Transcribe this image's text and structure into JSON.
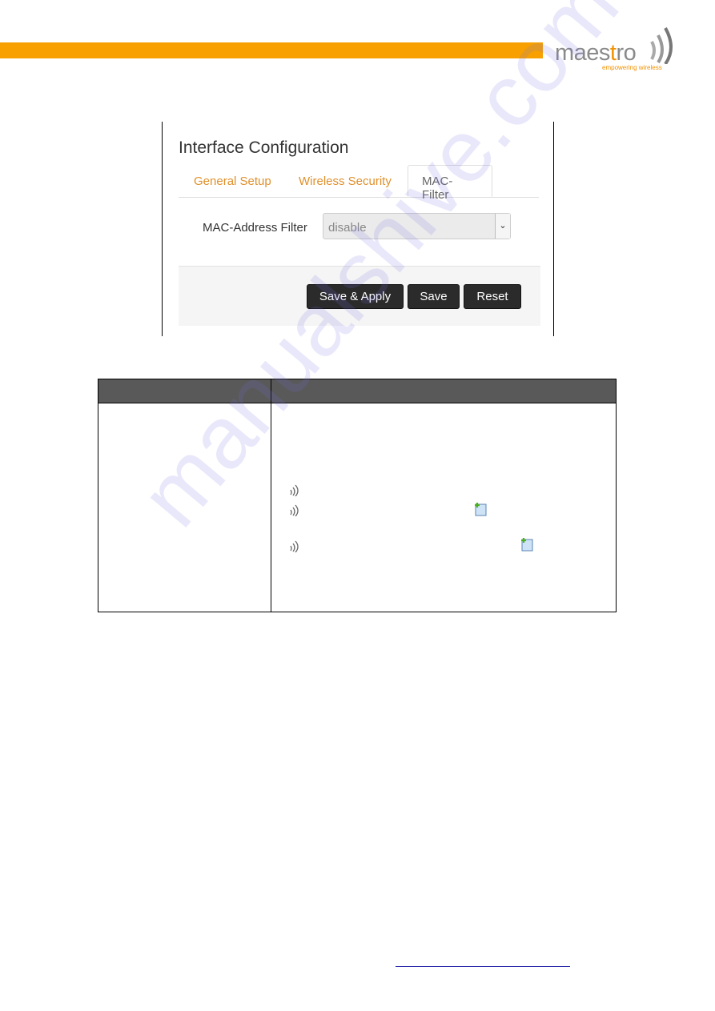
{
  "header": {
    "brand_color": "#f7a000"
  },
  "logo": {
    "text": "maestro",
    "tagline": "empowering wireless"
  },
  "screenshot": {
    "title": "Interface Configuration",
    "tabs": [
      {
        "label": "General Setup",
        "active": false
      },
      {
        "label": "Wireless Security",
        "active": false
      },
      {
        "label": "MAC-Filter",
        "active": true
      }
    ],
    "field": {
      "label": "MAC-Address Filter",
      "value": "disable"
    },
    "buttons": {
      "save_apply": "Save & Apply",
      "save": "Save",
      "reset": "Reset"
    }
  },
  "table": {
    "bullet_icon": "wireless-waves-icon",
    "add_icon": "add-entry-icon"
  },
  "watermark": "manualshive.com"
}
